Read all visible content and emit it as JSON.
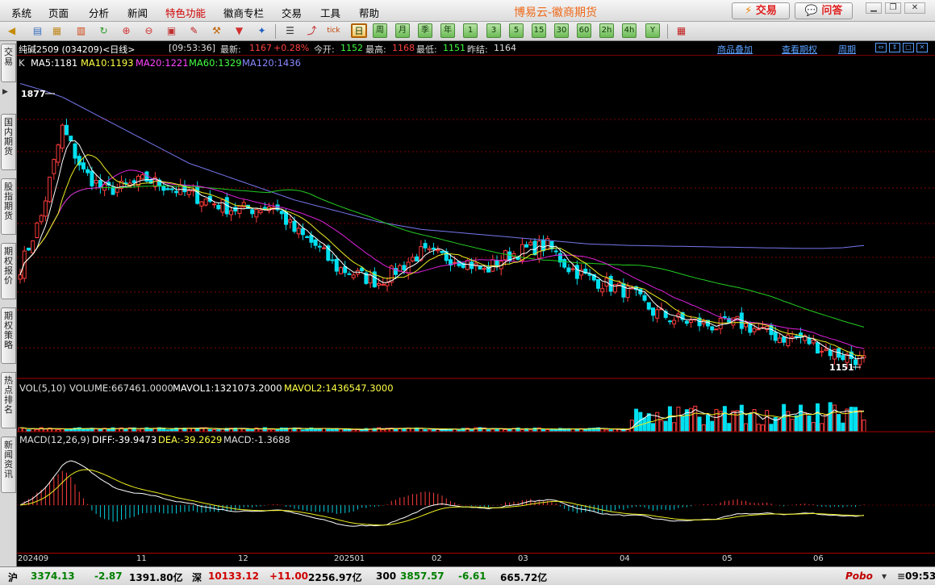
{
  "menu": [
    "系统",
    "页面",
    "分析",
    "新闻",
    "特色功能",
    "徽商专栏",
    "交易",
    "工具",
    "帮助"
  ],
  "app_title": "博易云-徽商期货",
  "buttons": {
    "trade": "交易",
    "ask": "问答"
  },
  "toolbar": {
    "period_buttons": [
      "日",
      "周",
      "月",
      "季",
      "年",
      "1",
      "3",
      "5",
      "15",
      "30",
      "60",
      "2h",
      "4h",
      "Y"
    ]
  },
  "side_tabs": [
    "交易",
    "国内期货",
    "股指期货",
    "期权报价",
    "期权策略",
    "热点排名",
    "新闻资讯"
  ],
  "info": {
    "symbol": "纯碱2509 (034209)<日线>",
    "time": "[09:53:36]",
    "latest_label": "最新:",
    "latest": "1167",
    "change": "+0.28%",
    "open_label": "今开:",
    "open": "1152",
    "high_label": "最高:",
    "high": "1168",
    "low_label": "最低:",
    "low": "1151",
    "prev_label": "昨结:",
    "prev": "1164",
    "link_overlay": "商品叠加",
    "link_options": "查看期权",
    "link_cycle": "周期"
  },
  "ma_legend": {
    "k": "K",
    "ma5": "MA5:1181",
    "ma10": "MA10:1193",
    "ma20": "MA20:1221",
    "ma60": "MA60:1329",
    "ma120": "MA120:1436"
  },
  "vol_legend": {
    "title": "VOL(5,10)",
    "volume": "VOLUME:667461.0000",
    "mavol1": "MAVOL1:1321073.2000",
    "mavol2": "MAVOL2:1436547.3000"
  },
  "macd_legend": {
    "title": "MACD(12,26,9)",
    "diff": "DIFF:-39.9473",
    "dea": "DEA:-39.2629",
    "macd": "MACD:-1.3688"
  },
  "price_marks": {
    "high": "1877",
    "low": "1151"
  },
  "x_axis": [
    "202409",
    "11",
    "12",
    "202501",
    "02",
    "03",
    "04",
    "05",
    "06"
  ],
  "status": {
    "sh_label": "沪",
    "sh_index": "3374.13",
    "sh_change": "-2.87",
    "sh_amount": "1391.80亿",
    "sz_label": "深",
    "sz_index": "10133.12",
    "sz_change": "+11.00",
    "sz_amount": "2256.97亿",
    "hs300_label": "300",
    "hs300_index": "3857.57",
    "hs300_change": "-6.61",
    "hs300_amount": "665.72亿",
    "brand": "Pobo",
    "clock": "09:53"
  },
  "chart_data": {
    "type": "candlestick",
    "x": [
      "2024-09-02",
      "2024-09-09",
      "2024-09-16",
      "2024-09-23",
      "2024-09-30",
      "2024-10-08",
      "2024-10-14",
      "2024-10-21",
      "2024-10-28",
      "2024-11-04",
      "2024-11-11",
      "2024-11-18",
      "2024-11-25",
      "2024-12-02",
      "2024-12-09",
      "2024-12-16",
      "2024-12-23",
      "2024-12-30",
      "2025-01-06",
      "2025-01-13",
      "2025-01-20",
      "2025-02-03",
      "2025-02-10",
      "2025-02-17",
      "2025-02-24",
      "2025-03-03",
      "2025-03-10",
      "2025-03-17",
      "2025-03-24",
      "2025-03-31",
      "2025-04-07",
      "2025-04-14",
      "2025-04-21",
      "2025-04-28",
      "2025-05-06",
      "2025-05-12",
      "2025-05-19",
      "2025-05-26",
      "2025-06-02",
      "2025-06-09",
      "2025-06-16"
    ],
    "close": [
      1420,
      1560,
      1800,
      1680,
      1630,
      1640,
      1660,
      1640,
      1620,
      1600,
      1580,
      1580,
      1590,
      1520,
      1480,
      1420,
      1400,
      1380,
      1420,
      1460,
      1450,
      1440,
      1410,
      1450,
      1470,
      1480,
      1420,
      1390,
      1370,
      1350,
      1300,
      1280,
      1270,
      1260,
      1270,
      1250,
      1230,
      1230,
      1200,
      1180,
      1167
    ],
    "ma5": [
      1420,
      1500,
      1620,
      1650,
      1640,
      1640,
      1650,
      1640,
      1630,
      1620,
      1600,
      1590,
      1580,
      1560,
      1530,
      1490,
      1460,
      1430,
      1420,
      1430,
      1440,
      1440,
      1430,
      1440,
      1450,
      1450,
      1430,
      1410,
      1390,
      1370,
      1340,
      1310,
      1290,
      1275,
      1265,
      1255,
      1245,
      1235,
      1220,
      1200,
      1181
    ],
    "ma120": [
      1877,
      1860,
      1840,
      1810,
      1780,
      1750,
      1720,
      1690,
      1660,
      1640,
      1620,
      1600,
      1580,
      1560,
      1545,
      1530,
      1515,
      1500,
      1490,
      1480,
      1475,
      1470,
      1465,
      1460,
      1455,
      1450,
      1445,
      1440,
      1438,
      1436,
      1435,
      1434,
      1433,
      1432,
      1431,
      1430,
      1429,
      1428,
      1428,
      1430,
      1436
    ],
    "ylim": [
      1140,
      1900
    ],
    "high_mark": 1877,
    "low_mark": 1151
  }
}
